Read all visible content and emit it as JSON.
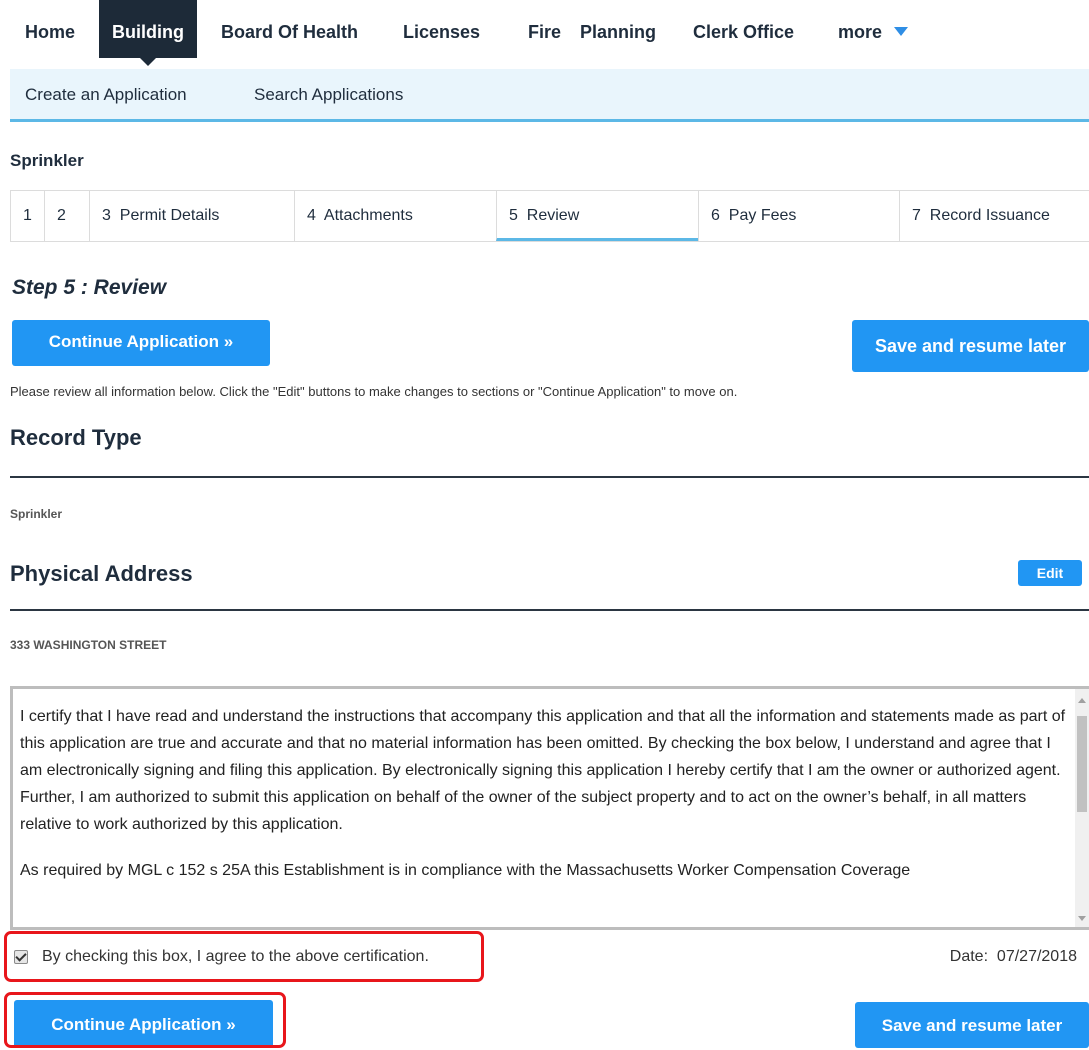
{
  "topnav": {
    "tabs": [
      {
        "label": "Home"
      },
      {
        "label": "Building"
      },
      {
        "label": "Board Of Health"
      },
      {
        "label": "Licenses"
      },
      {
        "label": "Fire"
      },
      {
        "label": "Planning"
      },
      {
        "label": "Clerk Office"
      },
      {
        "label": "more"
      }
    ],
    "active": "Building"
  },
  "subnav": {
    "items": [
      {
        "label": "Create an Application"
      },
      {
        "label": "Search Applications"
      }
    ]
  },
  "page": {
    "heading": "Sprinkler"
  },
  "steps": [
    {
      "number": "1",
      "label": ""
    },
    {
      "number": "2",
      "label": ""
    },
    {
      "number": "3",
      "label": "Permit Details"
    },
    {
      "number": "4",
      "label": "Attachments"
    },
    {
      "number": "5",
      "label": "Review"
    },
    {
      "number": "6",
      "label": "Pay Fees"
    },
    {
      "number": "7",
      "label": "Record Issuance"
    }
  ],
  "active_step": "5",
  "step_title": "Step 5 : Review",
  "buttons": {
    "continue": "Continue Application »",
    "save": "Save and resume later",
    "edit": "Edit"
  },
  "instructions": "Please review all information below. Click the \"Edit\" buttons to make changes to sections or \"Continue Application\" to move on.",
  "record_type": {
    "title": "Record Type",
    "value": "Sprinkler"
  },
  "physical_address": {
    "title": "Physical Address",
    "value": "333 WASHINGTON STREET"
  },
  "certification": {
    "paragraph1": "I certify that I have read and understand the instructions that accompany this application and that all the information and statements made as part of this application are true and accurate and that no material information has been omitted. By checking the box below, I understand and agree that I am electronically signing and filing this application. By electronically signing this application I hereby certify  that I am the owner or authorized agent. Further, I am authorized to submit this application on behalf of the owner of the subject property and to act on the owner’s behalf, in all matters relative to work authorized by this application.",
    "paragraph2": "As required by MGL c 152 s 25A this Establishment is in compliance with the Massachusetts Worker Compensation Coverage",
    "agree_label": "By checking this box, I agree to the above certification.",
    "agree_checked": true,
    "date_label": "Date:",
    "date_value": "07/27/2018"
  },
  "colors": {
    "accent": "#2196f3",
    "nav_active": "#1d2a38",
    "subnav_bg": "#e9f5fc",
    "highlight": "#e8161b"
  }
}
